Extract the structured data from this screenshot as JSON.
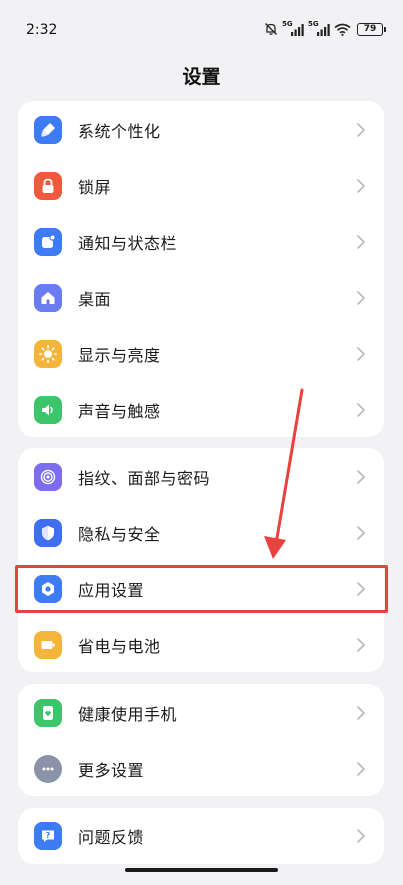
{
  "status_bar": {
    "time": "2:32",
    "signal1_label": "5G",
    "signal2_label": "5G",
    "battery": "79"
  },
  "page_title": "设置",
  "groups": [
    {
      "items": [
        {
          "label": "系统个性化",
          "icon": "brush-icon",
          "color": "#3d7cf5"
        },
        {
          "label": "锁屏",
          "icon": "lock-icon",
          "color": "#ef5a3c"
        },
        {
          "label": "通知与状态栏",
          "icon": "notification-icon",
          "color": "#3d7cf5"
        },
        {
          "label": "桌面",
          "icon": "home-icon",
          "color": "#6a7cf2"
        },
        {
          "label": "显示与亮度",
          "icon": "sun-icon",
          "color": "#f5b43a"
        },
        {
          "label": "声音与触感",
          "icon": "speaker-icon",
          "color": "#3cc56a"
        }
      ]
    },
    {
      "items": [
        {
          "label": "指纹、面部与密码",
          "icon": "fingerprint-icon",
          "color": "#7b6cf0"
        },
        {
          "label": "隐私与安全",
          "icon": "shield-icon",
          "color": "#3d6ff0"
        },
        {
          "label": "应用设置",
          "icon": "app-settings-icon",
          "color": "#3d7cf5"
        },
        {
          "label": "省电与电池",
          "icon": "battery-icon",
          "color": "#f5b43a"
        }
      ]
    },
    {
      "items": [
        {
          "label": "健康使用手机",
          "icon": "health-phone-icon",
          "color": "#3cc56a"
        },
        {
          "label": "更多设置",
          "icon": "more-icon",
          "color": "#8a93a8"
        }
      ]
    },
    {
      "items": [
        {
          "label": "问题反馈",
          "icon": "feedback-icon",
          "color": "#3d7cf5"
        }
      ]
    }
  ],
  "highlight_color": "#e8413e"
}
